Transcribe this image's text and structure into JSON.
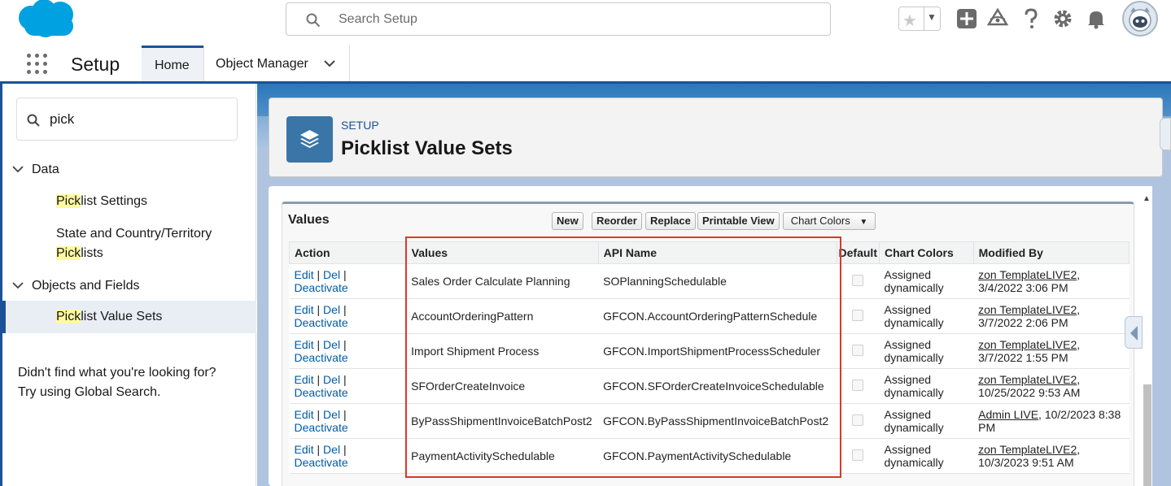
{
  "header": {
    "search_placeholder": "Search Setup",
    "icons": [
      "salesforce-logo",
      "star-icon",
      "chevron-down-icon",
      "add-icon",
      "trailhead-icon",
      "help-icon",
      "gear-icon",
      "bell-icon",
      "avatar"
    ]
  },
  "context_bar": {
    "app_name": "Setup",
    "tabs": [
      {
        "label": "Home"
      },
      {
        "label": "Object Manager"
      }
    ]
  },
  "sidebar": {
    "quick_find_value": "pick",
    "sections": [
      {
        "label": "Data"
      },
      {
        "label": "Objects and Fields"
      }
    ],
    "items": [
      {
        "highlight": "Pick",
        "rest": "list Settings"
      },
      {
        "prefix": "State and Country/Territory",
        "highlight": "Pick",
        "rest": "lists"
      },
      {
        "highlight": "Pick",
        "rest": "list Value Sets"
      }
    ],
    "not_found_line1": "Didn't find what you're looking for?",
    "not_found_line2": "Try using Global Search."
  },
  "page_header": {
    "eyebrow": "SETUP",
    "title": "Picklist Value Sets"
  },
  "values_panel": {
    "title": "Values",
    "buttons": {
      "new": "New",
      "reorder": "Reorder",
      "replace": "Replace",
      "printable_view": "Printable View",
      "chart_colors": "Chart Colors"
    },
    "columns": {
      "action": "Action",
      "values": "Values",
      "api_name": "API Name",
      "default": "Default",
      "chart_colors": "Chart Colors",
      "modified_by": "Modified By"
    },
    "action_labels": {
      "edit": "Edit",
      "del": "Del",
      "deactivate": "Deactivate",
      "sep": "|"
    },
    "rows": [
      {
        "value": "Sales Order Calculate Planning",
        "api": "SOPlanningSchedulable",
        "cc1": "Assigned",
        "cc2": "dynamically",
        "mod_user": "zon TemplateLIVE2",
        "mod_sep": ",",
        "mod_date": "3/4/2022 3:06 PM"
      },
      {
        "value": "AccountOrderingPattern",
        "api": "GFCON.AccountOrderingPatternSchedule",
        "cc1": "Assigned",
        "cc2": "dynamically",
        "mod_user": "zon TemplateLIVE2",
        "mod_sep": ",",
        "mod_date": "3/7/2022 2:06 PM"
      },
      {
        "value": "Import Shipment Process",
        "api": "GFCON.ImportShipmentProcessScheduler",
        "cc1": "Assigned",
        "cc2": "dynamically",
        "mod_user": "zon TemplateLIVE2",
        "mod_sep": ",",
        "mod_date": "3/7/2022 1:55 PM"
      },
      {
        "value": "SFOrderCreateInvoice",
        "api": "GFCON.SFOrderCreateInvoiceSchedulable",
        "cc1": "Assigned",
        "cc2": "dynamically",
        "mod_user": "zon TemplateLIVE2",
        "mod_sep": ",",
        "mod_date": "10/25/2022 9:53 AM"
      },
      {
        "value": "ByPassShipmentInvoiceBatchPost2",
        "api": "GFCON.ByPassShipmentInvoiceBatchPost2",
        "cc1": "Assigned",
        "cc2": "dynamically",
        "mod_user": "Admin LIVE",
        "mod_sep": ", 10/2/2023 8:38",
        "mod_date": "PM"
      },
      {
        "value": "PaymentActivitySchedulable",
        "api": "GFCON.PaymentActivitySchedulable",
        "cc1": "Assigned",
        "cc2": "dynamically",
        "mod_user": "zon TemplateLIVE2",
        "mod_sep": ",",
        "mod_date": "10/3/2023 9:51 AM"
      }
    ]
  },
  "colors": {
    "brand": "#1b5297",
    "link": "#015ba7",
    "highlight": "#fffaa0",
    "annotation_box": "#d9392b"
  }
}
